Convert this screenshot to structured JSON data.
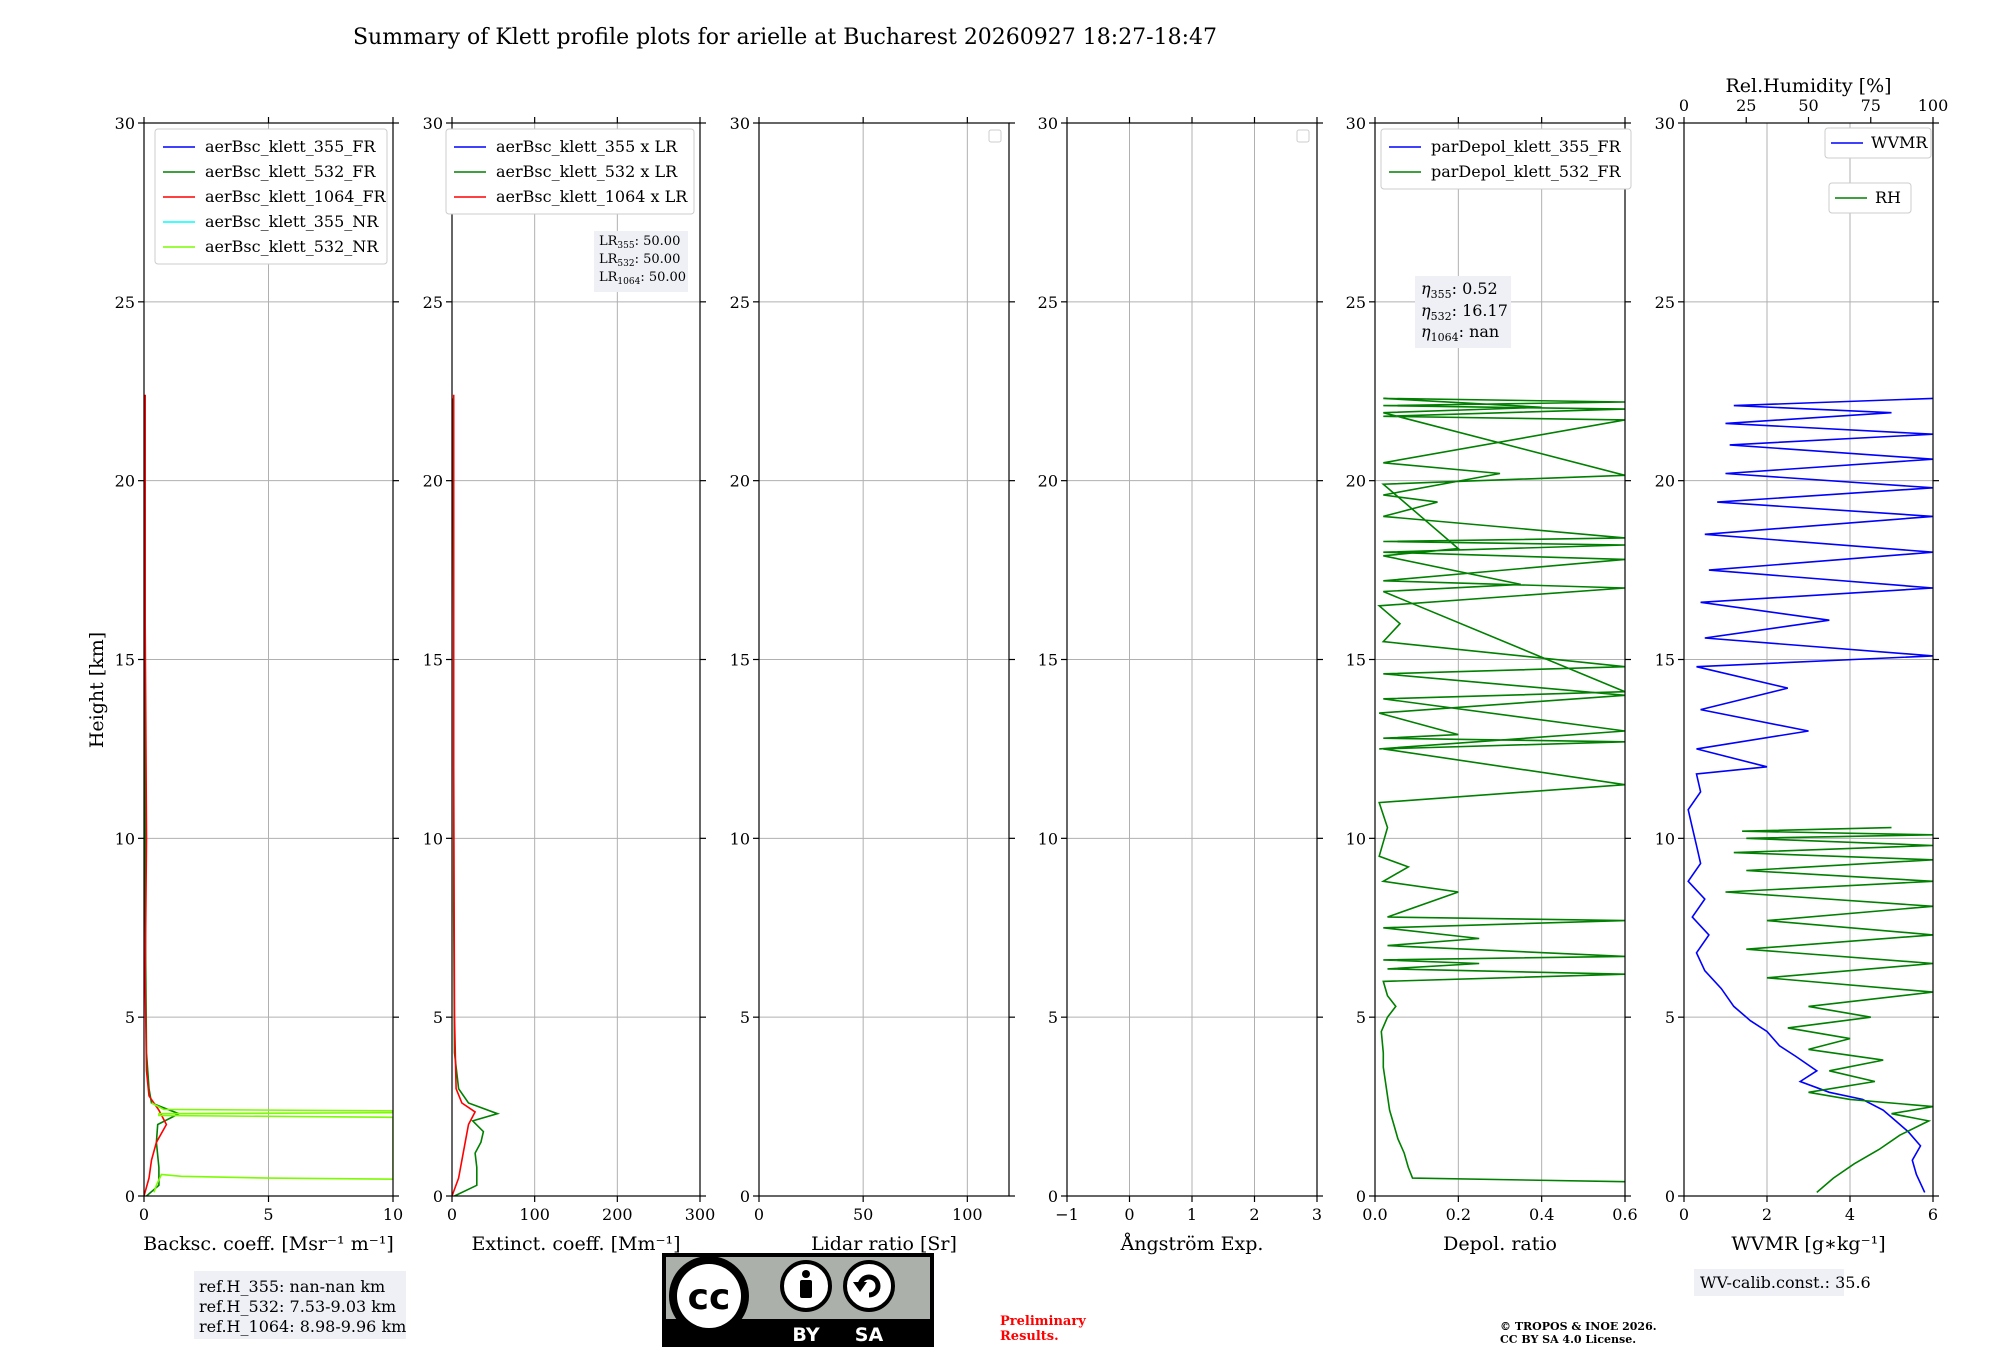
{
  "figure": {
    "title": "Summary of Klett profile plots for arielle at Bucharest 20260927 18:27-18:47",
    "ylabel": "Height [km]",
    "ref_heights": [
      "ref.H_355: nan-nan km",
      "ref.H_532: 7.53-9.03 km",
      "ref.H_1064: 8.98-9.96 km"
    ],
    "lidar_ratios": [
      {
        "name": "LR",
        "sub": "355",
        "value": ": 50.00"
      },
      {
        "name": "LR",
        "sub": "532",
        "value": ": 50.00"
      },
      {
        "name": "LR",
        "sub": "1064",
        "value": ": 50.00"
      }
    ],
    "eta_values": [
      {
        "name": "η",
        "sub": "355",
        "value": ": 0.52"
      },
      {
        "name": "η",
        "sub": "532",
        "value": ": 16.17"
      },
      {
        "name": "η",
        "sub": "1064",
        "value": ": nan"
      }
    ],
    "wv_calib": "WV-calib.const.: 35.6",
    "preliminary": [
      "Preliminary",
      "Results."
    ],
    "copyright": [
      "© TROPOS & INOE 2026.",
      "CC BY SA 4.0 License."
    ],
    "license_badge": {
      "cc": "cc",
      "by": "BY",
      "sa": "SA",
      "icons": [
        "person-icon",
        "share-alike-icon"
      ]
    },
    "colors": {
      "blue": "#0000ff",
      "green": "#008000",
      "red": "#ff0000",
      "cyan": "#00ffff",
      "lightgreen": "#7cfc00",
      "preliminary": "#ff0000"
    }
  },
  "chart_data": [
    {
      "type": "line",
      "xlabel": "Backsc. coeff. [Msr⁻¹ m⁻¹]",
      "ylabel": "Height [km]",
      "xlim": [
        0,
        10
      ],
      "ylim": [
        0,
        30
      ],
      "xticks": [
        "0",
        "5",
        "10"
      ],
      "xtick_values": [
        0,
        5,
        10
      ],
      "yticks": [
        "0",
        "5",
        "10",
        "15",
        "20",
        "25",
        "30"
      ],
      "grid": true,
      "legend": "top-right",
      "series": [
        {
          "name": "aerBsc_klett_355_FR",
          "color": "#0000ff",
          "x": [],
          "y": []
        },
        {
          "name": "aerBsc_klett_532_FR",
          "color": "#008000",
          "x": [
            0.1,
            0.6,
            0.6,
            0.5,
            0.55,
            1.4,
            0.3,
            0.2,
            0.1,
            0.05,
            0.05,
            0.03,
            0.03
          ],
          "y": [
            0,
            0.3,
            0.8,
            1.5,
            2.0,
            2.3,
            2.6,
            3.0,
            4.0,
            8.0,
            12.0,
            18.0,
            22.3
          ]
        },
        {
          "name": "aerBsc_klett_1064_FR",
          "color": "#ff0000",
          "x": [
            0.0,
            0.2,
            0.3,
            0.5,
            0.9,
            0.6,
            0.2,
            0.1,
            0.05,
            0.1,
            0.05,
            0.05
          ],
          "y": [
            0,
            0.5,
            1.0,
            1.5,
            2.0,
            2.4,
            2.8,
            3.5,
            6.0,
            10.0,
            16.0,
            22.4
          ]
        },
        {
          "name": "aerBsc_klett_355_NR",
          "color": "#00ffff",
          "x": [],
          "y": []
        },
        {
          "name": "aerBsc_klett_532_NR",
          "color": "#7cfc00",
          "x": [
            0.4,
            0.5,
            0.7,
            1.5,
            5.0,
            10,
            10,
            0.6,
            0.6,
            10,
            10,
            0.8,
            0.3
          ],
          "y": [
            0.1,
            0.3,
            0.6,
            0.55,
            0.5,
            0.47,
            2.2,
            2.25,
            2.3,
            2.33,
            2.38,
            2.42,
            2.6
          ]
        }
      ]
    },
    {
      "type": "line",
      "xlabel": "Extinct. coeff. [Mm⁻¹]",
      "xlim": [
        0,
        300
      ],
      "ylim": [
        0,
        30
      ],
      "xticks": [
        "0",
        "100",
        "200",
        "300"
      ],
      "xtick_values": [
        0,
        100,
        200,
        300
      ],
      "yticks": [
        "0",
        "5",
        "10",
        "15",
        "20",
        "25",
        "30"
      ],
      "grid": true,
      "legend": "top-right",
      "series": [
        {
          "name": "aerBsc_klett_355 x LR",
          "color": "#0000ff",
          "x": [],
          "y": []
        },
        {
          "name": "aerBsc_klett_532 x LR",
          "color": "#008000",
          "x": [
            3,
            30,
            30,
            28,
            35,
            38,
            25,
            55,
            20,
            8,
            3,
            2,
            2,
            1
          ],
          "y": [
            0,
            0.3,
            0.8,
            1.2,
            1.5,
            1.8,
            2.1,
            2.3,
            2.6,
            3.0,
            4.0,
            8.0,
            16.0,
            22.3
          ]
        },
        {
          "name": "aerBsc_klett_1064 x LR",
          "color": "#ff0000",
          "x": [
            0,
            8,
            12,
            16,
            20,
            28,
            12,
            5,
            3,
            2,
            2
          ],
          "y": [
            0,
            0.5,
            1.0,
            1.5,
            2.0,
            2.35,
            2.6,
            3.0,
            5.0,
            12.0,
            22.4
          ]
        }
      ]
    },
    {
      "type": "line",
      "xlabel": "Lidar ratio [Sr]",
      "xlim": [
        0,
        120
      ],
      "ylim": [
        0,
        30
      ],
      "xticks": [
        "0",
        "50",
        "100"
      ],
      "xtick_values": [
        0,
        50,
        100
      ],
      "yticks": [
        "0",
        "5",
        "10",
        "15",
        "20",
        "25",
        "30"
      ],
      "grid": true,
      "legend": "top-right",
      "series": []
    },
    {
      "type": "line",
      "xlabel": "Ångström Exp.",
      "xlim": [
        -1,
        3
      ],
      "ylim": [
        0,
        30
      ],
      "xticks": [
        "−1",
        "0",
        "1",
        "2",
        "3"
      ],
      "xtick_values": [
        -1,
        0,
        1,
        2,
        3
      ],
      "yticks": [
        "0",
        "5",
        "10",
        "15",
        "20",
        "25",
        "30"
      ],
      "grid": true,
      "legend": "top-right",
      "series": []
    },
    {
      "type": "line",
      "xlabel": "Depol. ratio",
      "xlim": [
        0,
        0.6
      ],
      "ylim": [
        0,
        30
      ],
      "xticks": [
        "0.0",
        "0.2",
        "0.4",
        "0.6"
      ],
      "xtick_values": [
        0,
        0.2,
        0.4,
        0.6
      ],
      "yticks": [
        "0",
        "5",
        "10",
        "15",
        "20",
        "25",
        "30"
      ],
      "grid": true,
      "legend": "top-left",
      "series": [
        {
          "name": "parDepol_klett_355_FR",
          "color": "#0000ff",
          "x": [],
          "y": []
        },
        {
          "name": "parDepol_klett_532_FR",
          "color": "#008000",
          "x": [
            0.6,
            0.09,
            0.08,
            0.07,
            0.055,
            0.045,
            0.035,
            0.03,
            0.025,
            0.02,
            0.02,
            0.015,
            0.03,
            0.05,
            0.03,
            0.02,
            0.6,
            0.03,
            0.25,
            0.02,
            0.6,
            0.03,
            0.25,
            0.02,
            0.6,
            0.03,
            0.2,
            0.02,
            0.08,
            0.01,
            0.03,
            0.01,
            0.6,
            0.02,
            0.6,
            0.02,
            0.2,
            0.01,
            0.6,
            0.02,
            0.6,
            0.02,
            0.06,
            0.01,
            0.6,
            0.02,
            0.6,
            0.02,
            0.6,
            0.02,
            0.6,
            0.02,
            0.15,
            0.02,
            0.3,
            0.02,
            0.6,
            0.02,
            0.6,
            0.02,
            0.6,
            0.02,
            0.4,
            0.02,
            0.6,
            0.02,
            0.2,
            0.02,
            0.35,
            0.02,
            0.6,
            0.02,
            0.6,
            0.01
          ],
          "y": [
            0.4,
            0.5,
            0.8,
            1.2,
            1.6,
            2.0,
            2.4,
            2.8,
            3.2,
            3.6,
            4.0,
            4.6,
            5.0,
            5.3,
            5.6,
            6.0,
            6.2,
            6.35,
            6.5,
            6.6,
            6.7,
            7.0,
            7.2,
            7.5,
            7.7,
            7.8,
            8.5,
            8.8,
            9.2,
            9.5,
            10.3,
            11.0,
            11.5,
            12.5,
            12.7,
            12.8,
            12.9,
            13.5,
            14.0,
            14.6,
            14.8,
            15.5,
            16.0,
            16.5,
            17.0,
            17.2,
            17.8,
            18.0,
            18.2,
            18.3,
            18.4,
            19.0,
            19.4,
            19.6,
            20.2,
            20.5,
            21.7,
            21.8,
            22.0,
            22.1,
            22.2,
            22.3,
            22.05,
            21.9,
            20.15,
            19.9,
            18.1,
            17.9,
            17.1,
            16.9,
            14.1,
            13.9,
            13.0,
            12.5
          ]
        }
      ]
    },
    {
      "type": "line",
      "xlabel": "WVMR [g∗kg⁻¹]",
      "x2label": "Rel.Humidity [%]",
      "xlim": [
        0,
        6
      ],
      "x2lim": [
        0,
        100
      ],
      "ylim": [
        0,
        30
      ],
      "xticks": [
        "0",
        "2",
        "4",
        "6"
      ],
      "xtick_values": [
        0,
        2,
        4,
        6
      ],
      "x2ticks": [
        "0",
        "25",
        "50",
        "75",
        "100"
      ],
      "x2tick_values": [
        0,
        25,
        50,
        75,
        100
      ],
      "yticks": [
        "0",
        "5",
        "10",
        "15",
        "20",
        "25",
        "30"
      ],
      "grid": true,
      "legend": "top-right",
      "series": [
        {
          "name": "WVMR",
          "color": "#0000ff",
          "x": [
            5.8,
            5.6,
            5.5,
            5.7,
            5.4,
            5.1,
            4.8,
            4.3,
            3.5,
            2.8,
            3.2,
            2.7,
            2.3,
            2.0,
            1.6,
            1.2,
            0.9,
            0.5,
            0.3,
            0.6,
            0.2,
            0.5,
            0.1,
            0.4,
            0.3,
            0.2,
            0.1,
            0.4,
            0.3,
            2.0,
            0.3,
            3.0,
            0.4,
            2.5,
            0.3,
            6.0,
            0.5,
            3.5,
            0.4,
            6.0,
            0.6,
            6.0,
            0.5,
            6.0,
            0.8,
            6.0,
            1.0,
            6.0,
            1.1,
            6.0,
            1.0,
            5.0,
            1.2,
            6.0
          ],
          "y": [
            0.1,
            0.6,
            1.0,
            1.4,
            1.8,
            2.1,
            2.4,
            2.7,
            2.9,
            3.2,
            3.5,
            3.9,
            4.2,
            4.6,
            4.9,
            5.3,
            5.8,
            6.3,
            6.8,
            7.3,
            7.8,
            8.3,
            8.8,
            9.3,
            9.8,
            10.3,
            10.8,
            11.3,
            11.8,
            12.0,
            12.5,
            13.0,
            13.6,
            14.2,
            14.8,
            15.1,
            15.6,
            16.1,
            16.6,
            17.0,
            17.5,
            18.0,
            18.5,
            19.0,
            19.4,
            19.8,
            20.2,
            20.6,
            21.0,
            21.3,
            21.6,
            21.9,
            22.1,
            22.3
          ]
        },
        {
          "name": "RH",
          "color": "#008000",
          "x": [
            3.2,
            3.6,
            4.1,
            4.7,
            5.2,
            5.9,
            5.0,
            6.0,
            4.0,
            3.0,
            4.6,
            3.5,
            4.8,
            3.0,
            4.0,
            2.5,
            4.5,
            3.0,
            6.0,
            2.0,
            6.0,
            1.5,
            6.0,
            2.0,
            6.0,
            1.0,
            6.0,
            1.5,
            6.0,
            1.2,
            6.0,
            1.5,
            6.0,
            1.4,
            5.0
          ],
          "y": [
            0.1,
            0.5,
            0.9,
            1.3,
            1.7,
            2.1,
            2.3,
            2.5,
            2.7,
            2.9,
            3.2,
            3.5,
            3.8,
            4.1,
            4.4,
            4.7,
            5.0,
            5.3,
            5.7,
            6.1,
            6.5,
            6.9,
            7.3,
            7.7,
            8.1,
            8.5,
            8.8,
            9.1,
            9.4,
            9.6,
            9.8,
            10.0,
            10.1,
            10.2,
            10.3
          ]
        }
      ]
    }
  ]
}
